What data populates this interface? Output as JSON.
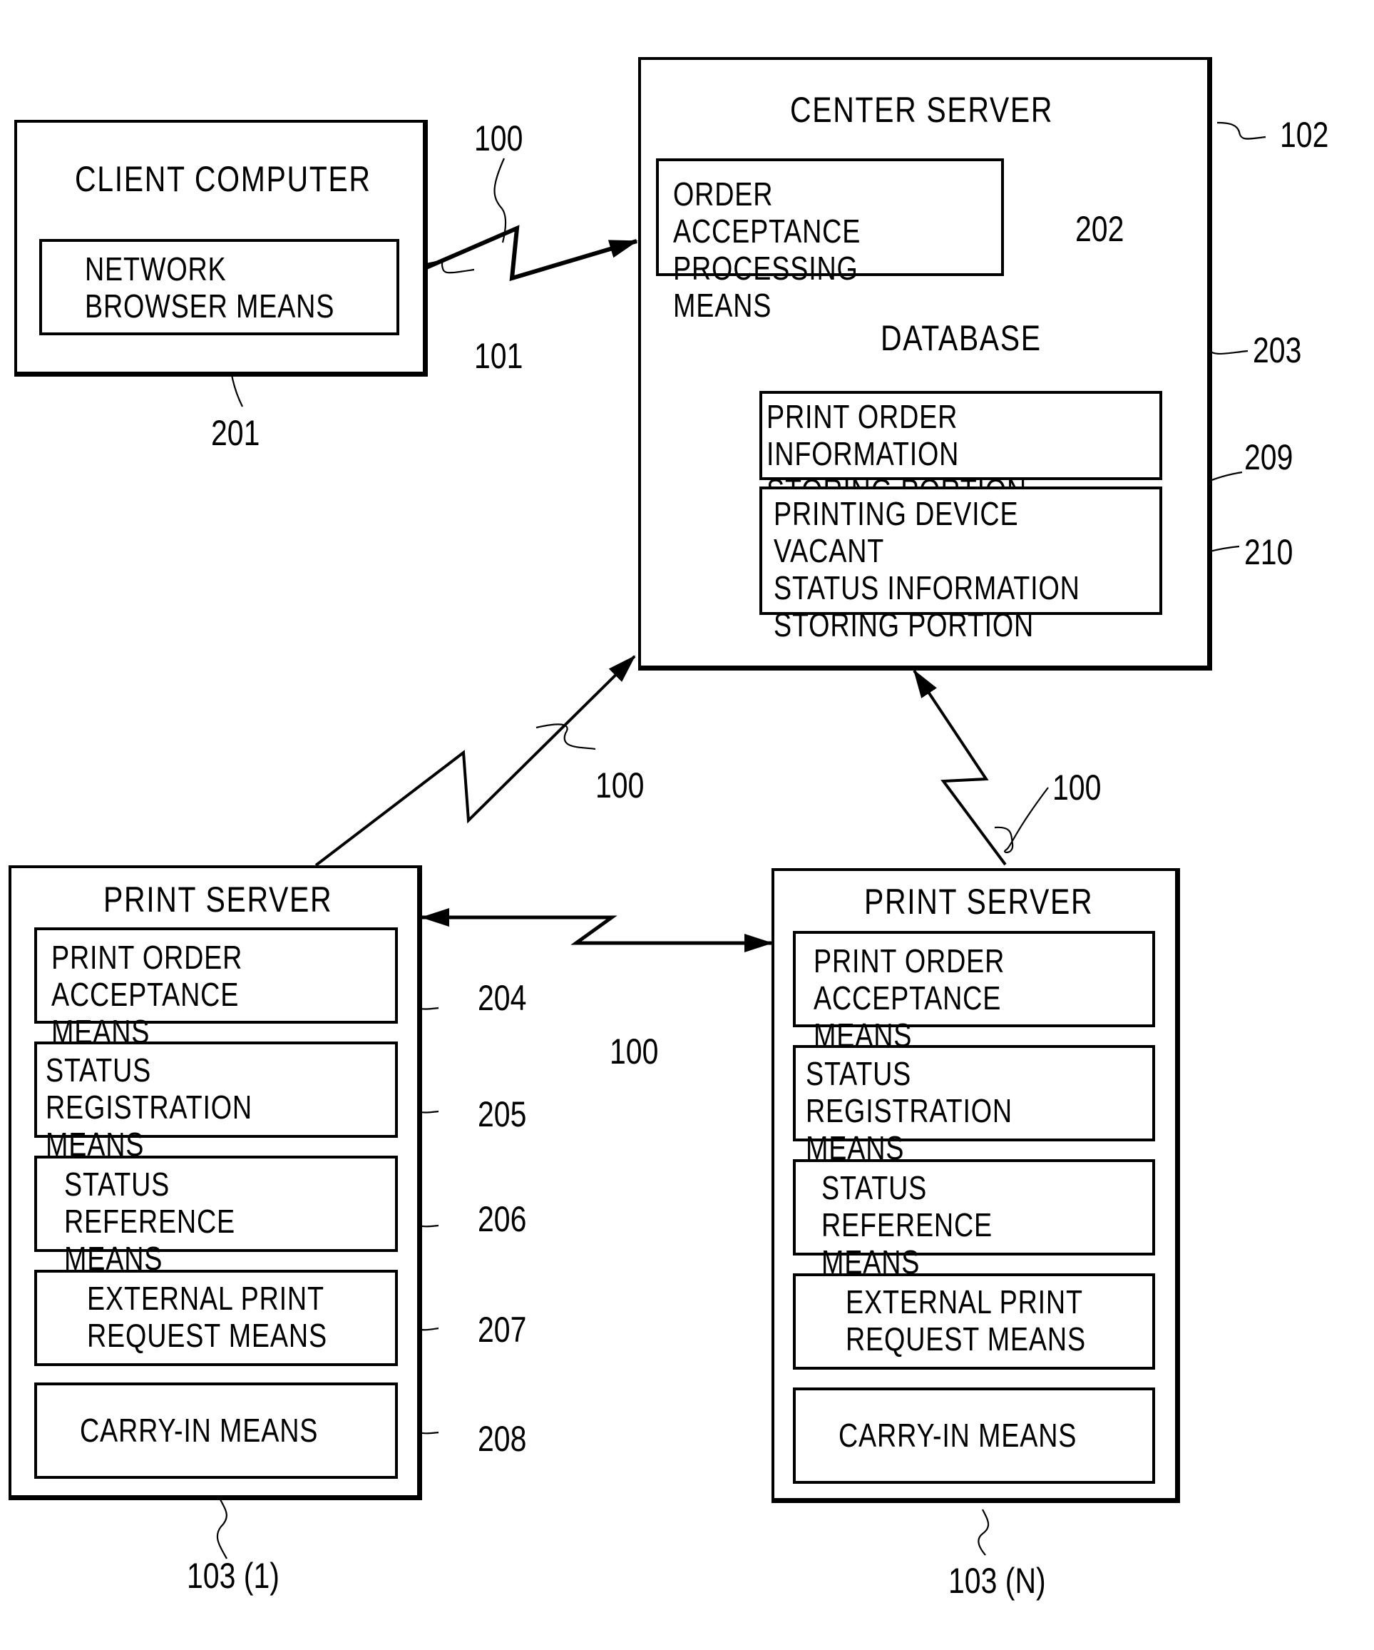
{
  "figure": {
    "client": {
      "title": "CLIENT COMPUTER",
      "ref": "101",
      "module": {
        "label": "NETWORK\nBROWSER MEANS",
        "ref": "201"
      }
    },
    "center_server": {
      "title": "CENTER SERVER",
      "ref": "102",
      "module": {
        "label": "ORDER ACCEPTANCE\nPROCESSING MEANS",
        "ref": "202"
      },
      "database": {
        "title": "DATABASE",
        "ref": "203",
        "portions": [
          {
            "label": "PRINT ORDER INFORMATION\nSTORING PORTION",
            "ref": "209"
          },
          {
            "label": "PRINTING DEVICE VACANT\nSTATUS INFORMATION\nSTORING PORTION",
            "ref": "210"
          }
        ]
      }
    },
    "print_server_1": {
      "title": "PRINT SERVER",
      "ref": "103 (1)",
      "modules": [
        {
          "label": "PRINT ORDER\nACCEPTANCE MEANS",
          "ref": "204"
        },
        {
          "label": "STATUS REGISTRATION\nMEANS",
          "ref": "205"
        },
        {
          "label": "STATUS REFERENCE\nMEANS",
          "ref": "206"
        },
        {
          "label": "EXTERNAL PRINT\nREQUEST MEANS",
          "ref": "207"
        },
        {
          "label": "CARRY-IN MEANS",
          "ref": "208"
        }
      ]
    },
    "print_server_n": {
      "title": "PRINT SERVER",
      "ref": "103 (N)",
      "modules": [
        {
          "label": "PRINT ORDER\nACCEPTANCE MEANS"
        },
        {
          "label": "STATUS REGISTRATION\nMEANS"
        },
        {
          "label": "STATUS REFERENCE\nMEANS"
        },
        {
          "label": "EXTERNAL PRINT\nREQUEST MEANS"
        },
        {
          "label": "CARRY-IN MEANS"
        }
      ]
    },
    "network": {
      "ref": "100",
      "links": [
        {
          "from": "CLIENT COMPUTER",
          "to": "CENTER SERVER",
          "ref": "100"
        },
        {
          "from": "PRINT SERVER 103 (1)",
          "to": "CENTER SERVER",
          "ref": "100"
        },
        {
          "from": "PRINT SERVER 103 (N)",
          "to": "CENTER SERVER",
          "ref": "100"
        },
        {
          "from": "PRINT SERVER 103 (1)",
          "to": "PRINT SERVER 103 (N)",
          "ref": "100",
          "bidirectional": true
        }
      ]
    }
  }
}
